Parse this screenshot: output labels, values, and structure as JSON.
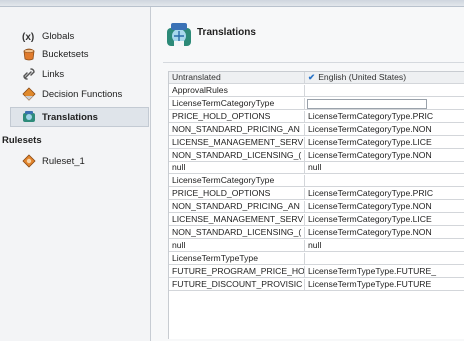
{
  "navigator": {
    "items": [
      {
        "label": "Globals",
        "icon": "globals-icon"
      },
      {
        "label": "Bucketsets",
        "icon": "bucketsets-icon"
      },
      {
        "label": "Links",
        "icon": "links-icon"
      },
      {
        "label": "Decision Functions",
        "icon": "decision-functions-icon"
      },
      {
        "label": "Translations",
        "icon": "translations-icon"
      }
    ],
    "section_title": "Rulesets",
    "rulesets": [
      {
        "label": "Ruleset_1",
        "icon": "ruleset-icon"
      }
    ]
  },
  "panel": {
    "title": "Translations"
  },
  "table": {
    "columns": [
      "Untranslated",
      "English (United States)"
    ],
    "rows": [
      [
        "ApprovalRules",
        ""
      ],
      [
        "LicenseTermCategoryType",
        ""
      ],
      [
        "PRICE_HOLD_OPTIONS",
        "LicenseTermCategoryType.PRIC"
      ],
      [
        "NON_STANDARD_PRICING_AN",
        "LicenseTermCategoryType.NON"
      ],
      [
        "LICENSE_MANAGEMENT_SERV",
        "LicenseTermCategoryType.LICE"
      ],
      [
        "NON_STANDARD_LICENSING_(",
        "LicenseTermCategoryType.NON"
      ],
      [
        "null",
        "null"
      ],
      [
        "LicenseTermCategoryType",
        ""
      ],
      [
        "PRICE_HOLD_OPTIONS",
        "LicenseTermCategoryType.PRIC"
      ],
      [
        "NON_STANDARD_PRICING_AN",
        "LicenseTermCategoryType.NON"
      ],
      [
        "LICENSE_MANAGEMENT_SERV",
        "LicenseTermCategoryType.LICE"
      ],
      [
        "NON_STANDARD_LICENSING_(",
        "LicenseTermCategoryType.NON"
      ],
      [
        "null",
        "null"
      ],
      [
        "LicenseTermTypeType",
        ""
      ],
      [
        "FUTURE_PROGRAM_PRICE_HO",
        "LicenseTermTypeType.FUTURE_"
      ],
      [
        "FUTURE_DISCOUNT_PROVISIC",
        "LicenseTermTypeType.FUTURE"
      ]
    ]
  },
  "colors": {
    "accent": "#2a74c8",
    "selection": "#dfe4ea"
  }
}
